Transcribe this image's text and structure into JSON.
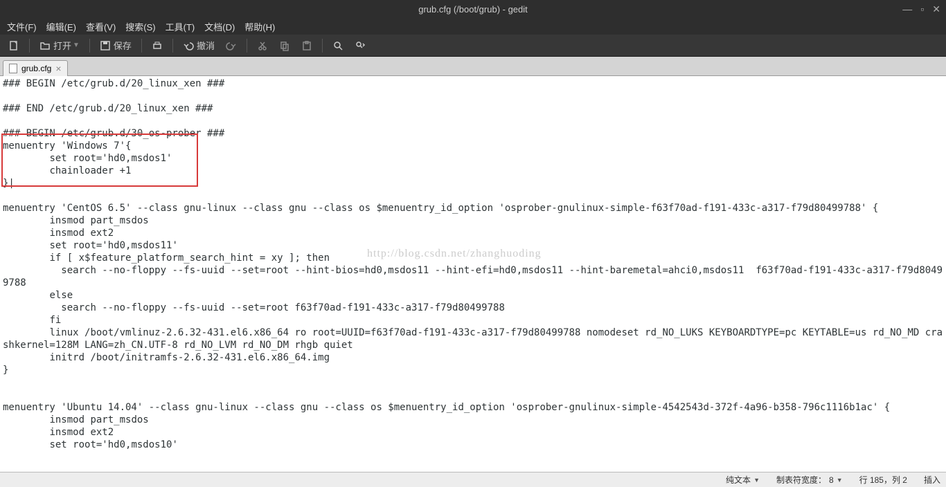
{
  "window": {
    "title": "grub.cfg (/boot/grub) - gedit"
  },
  "menubar": {
    "file": "文件(F)",
    "edit": "编辑(E)",
    "view": "查看(V)",
    "search": "搜索(S)",
    "tools": "工具(T)",
    "documents": "文档(D)",
    "help": "帮助(H)"
  },
  "toolbar": {
    "open": "打开",
    "save": "保存",
    "undo": "撤消"
  },
  "tab": {
    "filename": "grub.cfg"
  },
  "editor": {
    "lines": [
      "### BEGIN /etc/grub.d/20_linux_xen ###",
      "",
      "### END /etc/grub.d/20_linux_xen ###",
      "",
      "### BEGIN /etc/grub.d/30_os-prober ###",
      "menuentry 'Windows 7'{",
      "        set root='hd0,msdos1'",
      "        chainloader +1",
      "}|",
      "",
      "menuentry 'CentOS 6.5' --class gnu-linux --class gnu --class os $menuentry_id_option 'osprober-gnulinux-simple-f63f70ad-f191-433c-a317-f79d80499788' {",
      "        insmod part_msdos",
      "        insmod ext2",
      "        set root='hd0,msdos11'",
      "        if [ x$feature_platform_search_hint = xy ]; then",
      "          search --no-floppy --fs-uuid --set=root --hint-bios=hd0,msdos11 --hint-efi=hd0,msdos11 --hint-baremetal=ahci0,msdos11  f63f70ad-f191-433c-a317-f79d80499788",
      "        else",
      "          search --no-floppy --fs-uuid --set=root f63f70ad-f191-433c-a317-f79d80499788",
      "        fi",
      "        linux /boot/vmlinuz-2.6.32-431.el6.x86_64 ro root=UUID=f63f70ad-f191-433c-a317-f79d80499788 nomodeset rd_NO_LUKS KEYBOARDTYPE=pc KEYTABLE=us rd_NO_MD crashkernel=128M LANG=zh_CN.UTF-8 rd_NO_LVM rd_NO_DM rhgb quiet",
      "        initrd /boot/initramfs-2.6.32-431.el6.x86_64.img",
      "}",
      "",
      "",
      "menuentry 'Ubuntu 14.04' --class gnu-linux --class gnu --class os $menuentry_id_option 'osprober-gnulinux-simple-4542543d-372f-4a96-b358-796c1116b1ac' {",
      "        insmod part_msdos",
      "        insmod ext2",
      "        set root='hd0,msdos10'"
    ]
  },
  "watermark": "http://blog.csdn.net/zhanghuoding",
  "statusbar": {
    "syntax": "纯文本",
    "tabwidth_label": "制表符宽度：",
    "tabwidth_value": "8",
    "position": "行 185，列 2",
    "mode": "插入"
  }
}
